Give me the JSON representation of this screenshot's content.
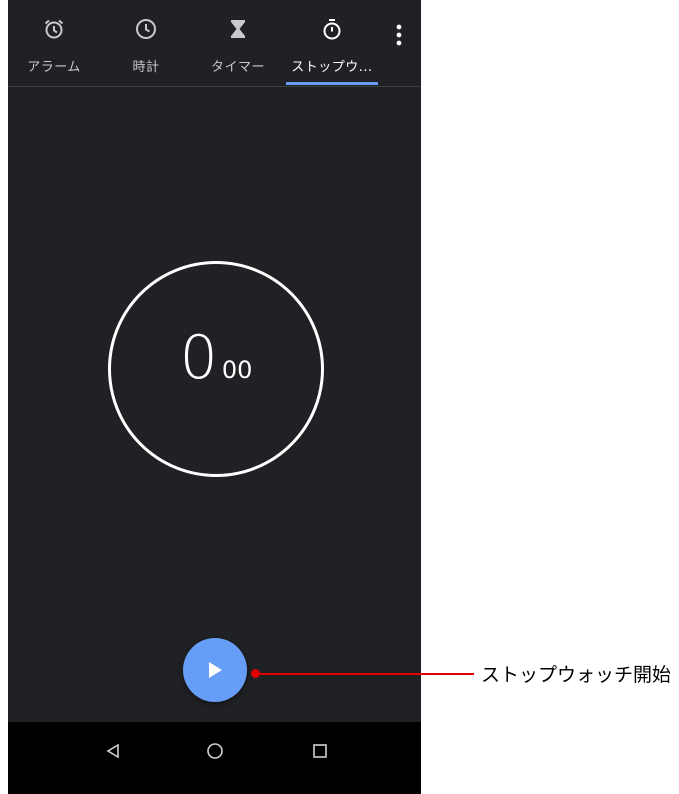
{
  "tabs": [
    {
      "label": "アラーム",
      "icon": "alarm-icon"
    },
    {
      "label": "時計",
      "icon": "clock-icon"
    },
    {
      "label": "タイマー",
      "icon": "hourglass-icon"
    },
    {
      "label": "ストップウ...",
      "icon": "stopwatch-icon",
      "active": true
    }
  ],
  "menu": {
    "icon": "more-vert-icon"
  },
  "stopwatch": {
    "seconds": "0",
    "hundredths": "00"
  },
  "fab": {
    "icon": "play-icon"
  },
  "nav": {
    "back": "back-icon",
    "home": "home-icon",
    "recents": "recents-icon"
  },
  "annotation": {
    "label": "ストップウォッチ開始",
    "color": "#e00000"
  },
  "colors": {
    "background": "#202124",
    "accent": "#669df6",
    "navbar": "#000000"
  }
}
